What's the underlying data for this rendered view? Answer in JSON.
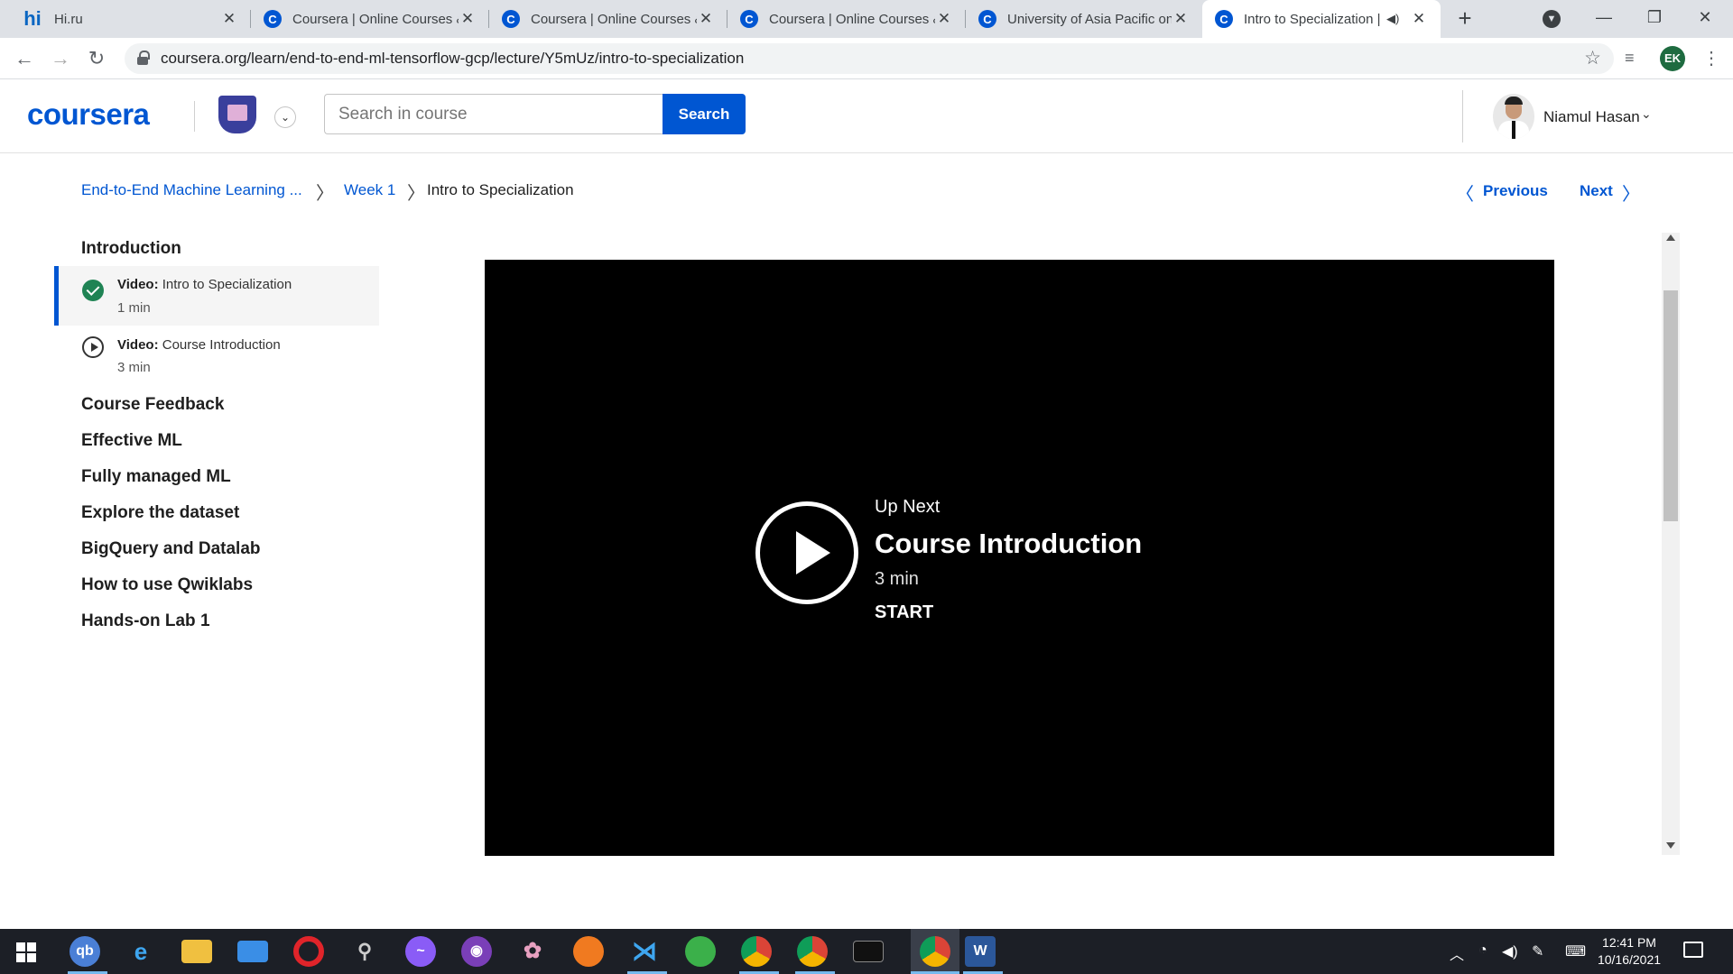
{
  "browser": {
    "tabs": [
      {
        "title": "Hi.ru",
        "favicon": "hi-icon"
      },
      {
        "title": "Coursera | Online Courses &",
        "favicon": "coursera-icon"
      },
      {
        "title": "Coursera | Online Courses &",
        "favicon": "coursera-icon"
      },
      {
        "title": "Coursera | Online Courses &",
        "favicon": "coursera-icon"
      },
      {
        "title": "University of Asia Pacific on",
        "favicon": "coursera-icon"
      },
      {
        "title": "Intro to Specialization |",
        "favicon": "coursera-icon",
        "active": true,
        "audio": "speaker-muted-icon"
      }
    ],
    "new_tab_label": "+",
    "url": "coursera.org/learn/end-to-end-ml-tensorflow-gcp/lecture/Y5mUz/intro-to-specialization",
    "profile_initials": "EK"
  },
  "header": {
    "logo_text": "coursera",
    "search_placeholder": "Search in course",
    "search_button": "Search",
    "user_name": "Niamul Hasan",
    "brand_color": "#0056d2"
  },
  "breadcrumb": {
    "course": "End-to-End Machine Learning ...",
    "week": "Week 1",
    "current": "Intro to Specialization"
  },
  "lesson_nav": {
    "previous": "Previous",
    "next": "Next"
  },
  "sidebar": {
    "current_section": "Introduction",
    "items": [
      {
        "type_label": "Video:",
        "title": "Intro to Specialization",
        "duration": "1 min",
        "status": "completed",
        "icon": "check-circle-icon"
      },
      {
        "type_label": "Video:",
        "title": "Course Introduction",
        "duration": "3 min",
        "status": "not-started",
        "icon": "play-circle-icon"
      }
    ],
    "sections": [
      "Course Feedback",
      "Effective ML",
      "Fully managed ML",
      "Explore the dataset",
      "BigQuery and Datalab",
      "How to use Qwiklabs",
      "Hands-on Lab 1"
    ]
  },
  "video": {
    "up_next_label": "Up Next",
    "next_title": "Course Introduction",
    "next_duration": "3 min",
    "start_label": "START"
  },
  "taskbar": {
    "apps": [
      "qb",
      "e",
      "folder",
      "mail",
      "opera",
      "app",
      "messenger",
      "github",
      "app",
      "firefox",
      "vscode",
      "app",
      "chrome",
      "chrome",
      "terminal",
      "chrome",
      "word"
    ],
    "time": "12:41 PM",
    "date": "10/16/2021"
  }
}
